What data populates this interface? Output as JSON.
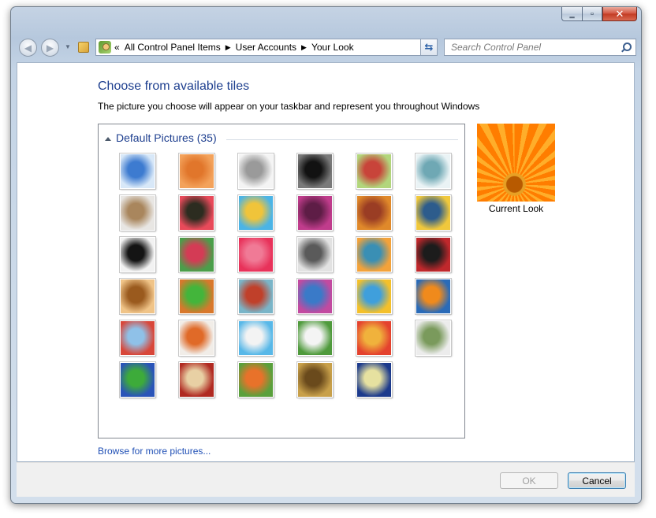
{
  "window": {
    "controls": [
      "minimize-icon",
      "maximize-icon",
      "close-icon"
    ],
    "close_glyph": "✕",
    "max_glyph": "▫",
    "min_glyph": "‗"
  },
  "navigation": {
    "back_glyph": "◀",
    "forward_glyph": "▶",
    "dropdown_glyph": "▼",
    "breadcrumb_prefix": "«",
    "breadcrumb": [
      "All Control Panel Items",
      "User Accounts",
      "Your Look"
    ],
    "breadcrumb_separator": "▶",
    "refresh_glyph": "⇆",
    "search_placeholder": "Search Control Panel"
  },
  "main": {
    "title": "Choose from available tiles",
    "description": "The picture you choose will appear on your taskbar and represent you throughout Windows",
    "group_label": "Default Pictures (35)",
    "current_label": "Current Look",
    "browse_link": "Browse for more pictures..."
  },
  "tiles": [
    {
      "name": "tile-ferris-wheel",
      "colors": [
        "#d8e8f8",
        "#3d7bd0"
      ]
    },
    {
      "name": "tile-starfish",
      "colors": [
        "#f3a25b",
        "#e1762b"
      ]
    },
    {
      "name": "tile-robot-toy",
      "colors": [
        "#f4f4f4",
        "#9a9a9a"
      ]
    },
    {
      "name": "tile-turntable",
      "colors": [
        "#7a7a7a",
        "#121212"
      ]
    },
    {
      "name": "tile-lucky-cat",
      "colors": [
        "#b2d67c",
        "#c8443a"
      ]
    },
    {
      "name": "tile-gyroscope",
      "colors": [
        "#eaf3f5",
        "#6fa8b4"
      ]
    },
    {
      "name": "tile-kitten",
      "colors": [
        "#e8e6e3",
        "#a9865d"
      ]
    },
    {
      "name": "tile-pink-flower",
      "colors": [
        "#e84a5a",
        "#2c2c20"
      ]
    },
    {
      "name": "tile-pinwheel",
      "colors": [
        "#4bb4e6",
        "#f0c43a"
      ]
    },
    {
      "name": "tile-ball",
      "colors": [
        "#c03c8c",
        "#5e1d46"
      ]
    },
    {
      "name": "tile-fabric",
      "colors": [
        "#e0892a",
        "#9a3d24"
      ]
    },
    {
      "name": "tile-yellow-leaf",
      "colors": [
        "#f0c83c",
        "#2d5c8c"
      ]
    },
    {
      "name": "tile-border-collie",
      "colors": [
        "#f2f2f2",
        "#141414"
      ]
    },
    {
      "name": "tile-crayons",
      "colors": [
        "#4b9e4a",
        "#d43b55"
      ]
    },
    {
      "name": "tile-red-star",
      "colors": [
        "#e8325a",
        "#f07a96"
      ]
    },
    {
      "name": "tile-jacks",
      "colors": [
        "#e2e2e2",
        "#5a5a5a"
      ]
    },
    {
      "name": "tile-stairs",
      "colors": [
        "#f3a23a",
        "#3a8fb4"
      ]
    },
    {
      "name": "tile-origami-crane",
      "colors": [
        "#c0282c",
        "#1c1c1c"
      ]
    },
    {
      "name": "tile-guitar",
      "colors": [
        "#f0c488",
        "#9a5a1e"
      ]
    },
    {
      "name": "tile-pomeranian",
      "colors": [
        "#d8782c",
        "#43b53b"
      ]
    },
    {
      "name": "tile-tin-robot",
      "colors": [
        "#7ab5c8",
        "#c0402a"
      ]
    },
    {
      "name": "tile-silk-scarves",
      "colors": [
        "#c24aa0",
        "#3a7ac8"
      ]
    },
    {
      "name": "tile-sunflower",
      "colors": [
        "#f4c02a",
        "#3f9fdc"
      ]
    },
    {
      "name": "tile-fish",
      "colors": [
        "#2a6bb8",
        "#f08a1c"
      ]
    },
    {
      "name": "tile-hot-air-balloon",
      "colors": [
        "#d8473a",
        "#8fc1e8"
      ]
    },
    {
      "name": "tile-kokeshi-doll",
      "colors": [
        "#f1ede8",
        "#e06a28"
      ]
    },
    {
      "name": "tile-sailboat",
      "colors": [
        "#58b8e8",
        "#f3f3f3"
      ]
    },
    {
      "name": "tile-soccer-ball",
      "colors": [
        "#4f9a3c",
        "#f4f4f4"
      ]
    },
    {
      "name": "tile-striped-fabric",
      "colors": [
        "#e4422e",
        "#f0b23c"
      ]
    },
    {
      "name": "tile-marbles",
      "colors": [
        "#ececec",
        "#7a9a5c"
      ]
    },
    {
      "name": "tile-green-window",
      "colors": [
        "#2a54b8",
        "#3dab3a"
      ]
    },
    {
      "name": "tile-rug-pattern",
      "colors": [
        "#b02a22",
        "#e8d0a4"
      ]
    },
    {
      "name": "tile-butterfly",
      "colors": [
        "#5aa03c",
        "#e8722a"
      ]
    },
    {
      "name": "tile-wicker-spiral",
      "colors": [
        "#c8a04a",
        "#6a4a1c"
      ]
    },
    {
      "name": "tile-lighthouse",
      "colors": [
        "#1c3a8c",
        "#e6e1a0"
      ]
    }
  ],
  "footer": {
    "ok_label": "OK",
    "cancel_label": "Cancel"
  }
}
